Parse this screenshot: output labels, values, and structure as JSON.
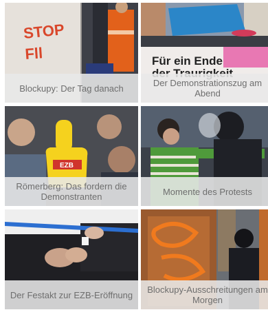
{
  "gallery": {
    "items": [
      {
        "caption": "Blockupy: Der Tag danach",
        "image_alt": "graffiti-wall-photo"
      },
      {
        "caption": "Der Demonstrationszug am Abend",
        "image_alt": "demonstration-march-photo"
      },
      {
        "caption": "Römerberg: Das fordern die Demonstranten",
        "image_alt": "protest-hand-sign-photo"
      },
      {
        "caption": "Momente des Protests",
        "image_alt": "protest-clash-photo"
      },
      {
        "caption": "Der Festakt zur EZB-Eröffnung",
        "image_alt": "ribbon-cutting-photo"
      },
      {
        "caption": "Blockupy-Ausschreitungen am Morgen",
        "image_alt": "vandalized-door-photo"
      }
    ],
    "scene_text": {
      "graffiti_line1": "STOP",
      "graffiti_line2": "Fll",
      "banner_text_line1": "Für ein Ende",
      "banner_text_line2": "der Traurigkeit",
      "sign_text": "EZB"
    }
  }
}
